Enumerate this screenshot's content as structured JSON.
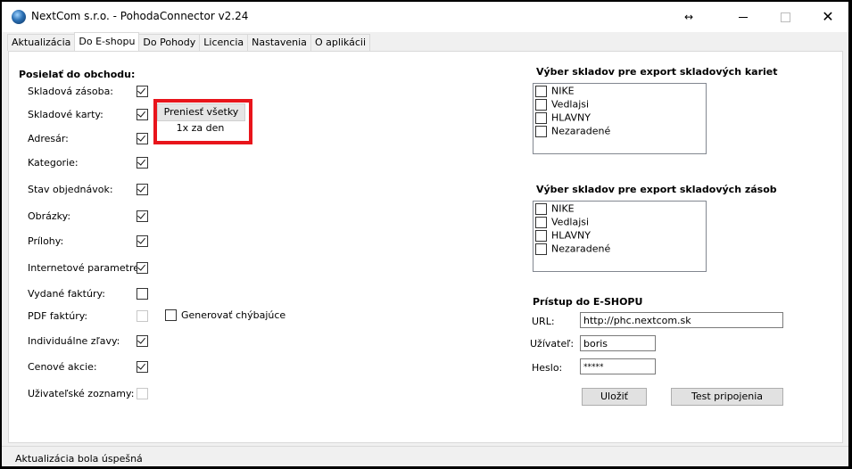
{
  "window": {
    "title": "NextCom s.r.o. - PohodaConnector v2.24"
  },
  "titlebar": {
    "resize_glyph": "↔",
    "close_glyph": "✕"
  },
  "tabs": [
    {
      "label": "Aktualizácia"
    },
    {
      "label": "Do E-shopu",
      "active": true
    },
    {
      "label": "Do Pohody"
    },
    {
      "label": "Licencia"
    },
    {
      "label": "Nastavenia"
    },
    {
      "label": "O aplikácii"
    }
  ],
  "send": {
    "title": "Posielať do obchodu:",
    "rows": [
      {
        "label": "Skladová zásoba:",
        "checked": true,
        "enabled": true
      },
      {
        "label": "Skladové karty:",
        "checked": true,
        "enabled": true
      },
      {
        "label": "Adresár:",
        "checked": true,
        "enabled": true
      },
      {
        "label": "Kategorie:",
        "checked": true,
        "enabled": true
      },
      {
        "label": "Stav objednávok:",
        "checked": true,
        "enabled": true
      },
      {
        "label": "Obrázky:",
        "checked": true,
        "enabled": true
      },
      {
        "label": "Prílohy:",
        "checked": true,
        "enabled": true
      },
      {
        "label": "Internetové parametre:",
        "checked": true,
        "enabled": true
      },
      {
        "label": "Vydané faktúry:",
        "checked": false,
        "enabled": true
      },
      {
        "label": "PDF faktúry:",
        "checked": false,
        "enabled": false
      },
      {
        "label": "Individuálne zľavy:",
        "checked": true,
        "enabled": true
      },
      {
        "label": "Cenové akcie:",
        "checked": true,
        "enabled": true
      },
      {
        "label": "Uživateľské zoznamy:",
        "checked": false,
        "enabled": false
      }
    ],
    "generate_missing": {
      "label": "Generovať chýbajúce",
      "checked": false
    }
  },
  "popup": {
    "item1": "Preniesť všetky",
    "item2": "1x za den"
  },
  "cards_warehouses": {
    "title": "Výber skladov pre export skladových kariet",
    "items": [
      {
        "label": "NIKE",
        "checked": false
      },
      {
        "label": "Vedlajsi",
        "checked": false
      },
      {
        "label": "HLAVNY",
        "checked": false
      },
      {
        "label": "Nezaradené",
        "checked": false
      }
    ]
  },
  "stock_warehouses": {
    "title": "Výber skladov pre export skladových zásob",
    "items": [
      {
        "label": "NIKE",
        "checked": false
      },
      {
        "label": "Vedlajsi",
        "checked": false
      },
      {
        "label": "HLAVNY",
        "checked": false
      },
      {
        "label": "Nezaradené",
        "checked": false
      }
    ]
  },
  "eshop": {
    "title": "Prístup do E-SHOPU",
    "url_label": "URL:",
    "url_value": "http://phc.nextcom.sk",
    "user_label": "Užívateľ:",
    "user_value": "boris",
    "password_label": "Heslo:",
    "password_value": "*****",
    "save_label": "Uložiť",
    "test_label": "Test pripojenia"
  },
  "status": {
    "text": "Aktualizácia bola úspešná"
  }
}
